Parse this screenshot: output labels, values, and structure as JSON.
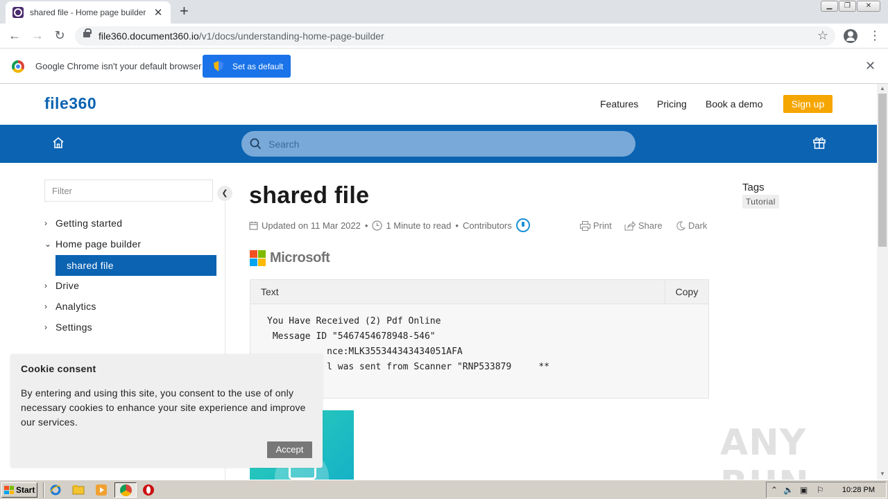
{
  "browser": {
    "tab_title": "shared file - Home page builder",
    "tab_close": "✕",
    "new_tab": "+",
    "url_host": "file360.document360.io",
    "url_path": "/v1/docs/understanding-home-page-builder",
    "infobar_text": "Google Chrome isn't your default browser",
    "set_default_label": "Set as default",
    "infobar_close": "✕"
  },
  "site": {
    "logo": "file360",
    "nav": [
      "Features",
      "Pricing",
      "Book a demo"
    ],
    "signup_label": "Sign up",
    "search_placeholder": "Search"
  },
  "sidebar": {
    "filter_placeholder": "Filter",
    "items": [
      {
        "label": "Getting started",
        "chevron": "›"
      },
      {
        "label": "Home page builder",
        "chevron": "⌄"
      },
      {
        "label": "Drive",
        "chevron": "›"
      },
      {
        "label": "Analytics",
        "chevron": "›"
      },
      {
        "label": "Settings",
        "chevron": "›"
      }
    ],
    "active_sub_item": "shared file"
  },
  "article": {
    "title": "shared file",
    "updated": "Updated on 11 Mar 2022",
    "read_time": "1 Minute to read",
    "contributors_label": "Contributors",
    "actions": {
      "print": "Print",
      "share": "Share",
      "dark": "Dark"
    },
    "logo_word": "Microsoft",
    "code_header": "Text",
    "copy_label": "Copy",
    "code_lines": [
      "You Have Received (2) Pdf Online",
      " Message ID \"5467454678948-546\"",
      "",
      "           nce:MLK355344343434051AFA",
      "           l was sent from Scanner \"RNP533879     **"
    ]
  },
  "tags": {
    "title": "Tags",
    "items": [
      "Tutorial"
    ]
  },
  "cookie": {
    "title": "Cookie consent",
    "body": "By entering and using this site, you consent to the use of only necessary cookies to enhance your site experience and improve our services.",
    "accept_label": "Accept"
  },
  "watermark": "ANY RUN",
  "taskbar": {
    "start_label": "Start",
    "clock": "10:28 PM"
  },
  "colors": {
    "brand_blue": "#0b63b2",
    "signup_orange": "#f6a600",
    "chrome_blue": "#1a73e8"
  }
}
